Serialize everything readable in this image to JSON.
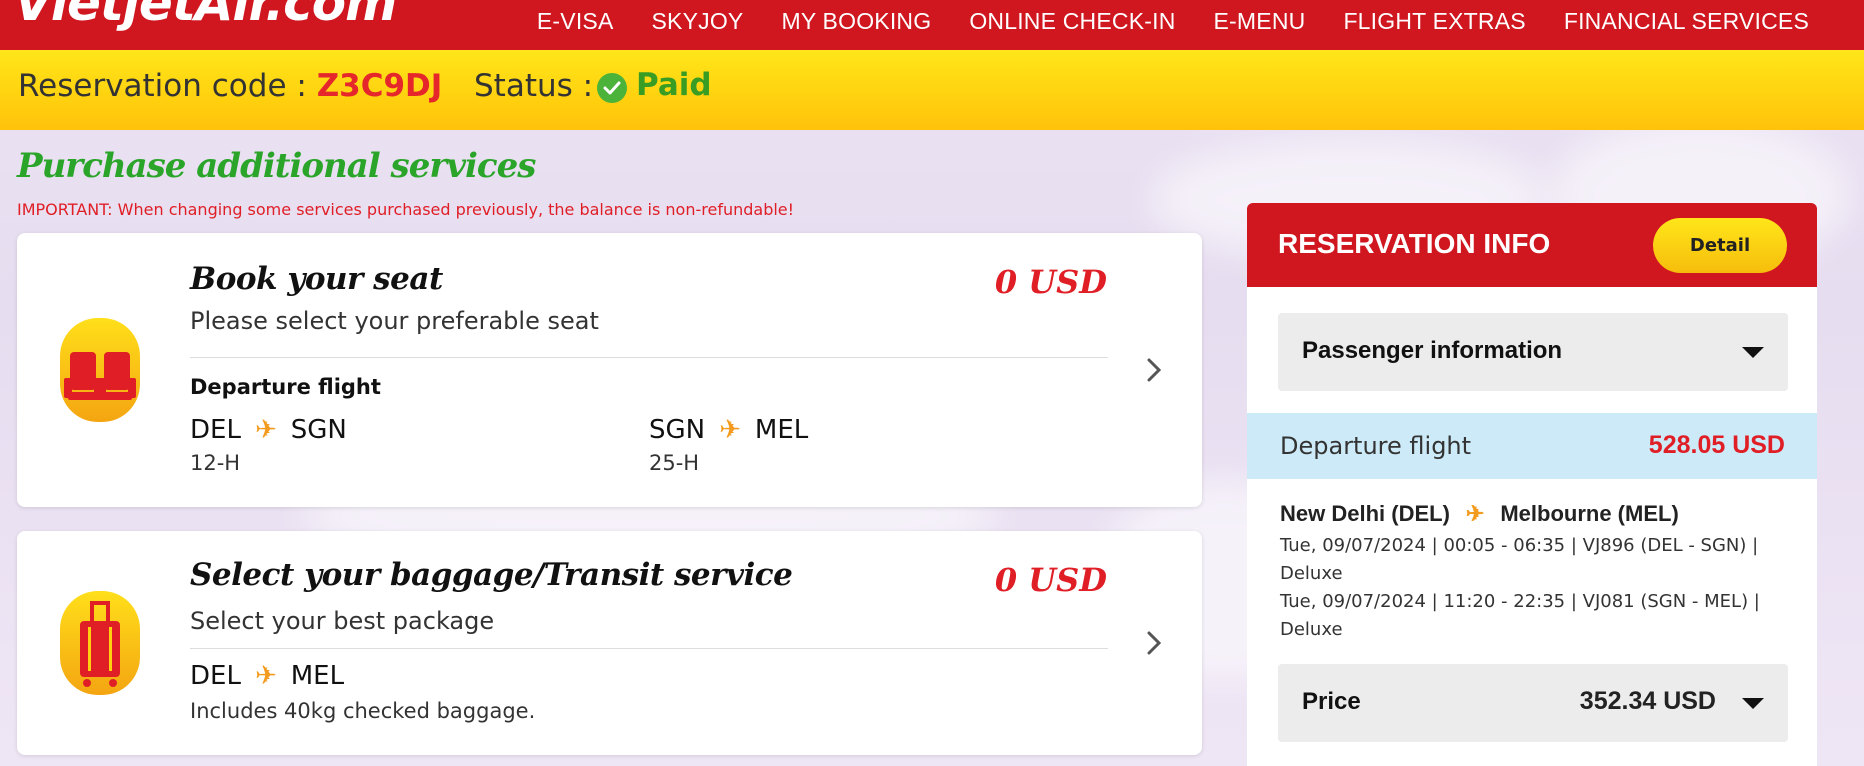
{
  "brand": {
    "logo_text": "VietjetAir.com"
  },
  "nav": {
    "items": [
      "E-VISA",
      "SKYJOY",
      "MY BOOKING",
      "ONLINE CHECK-IN",
      "E-MENU",
      "FLIGHT EXTRAS",
      "FINANCIAL SERVICES"
    ]
  },
  "status_bar": {
    "reservation_label": "Reservation code : ",
    "reservation_code": "Z3C9DJ",
    "status_label": "Status :",
    "status_value": "Paid"
  },
  "main": {
    "title": "Purchase additional services",
    "important": "IMPORTANT: When changing some services purchased previously, the balance is non-refundable!",
    "seat_card": {
      "title": "Book your seat",
      "subtitle": "Please select your preferable seat",
      "price": "0 USD",
      "flight_label": "Departure flight",
      "legs": [
        {
          "from": "DEL",
          "to": "SGN",
          "seat": "12-H"
        },
        {
          "from": "SGN",
          "to": "MEL",
          "seat": "25-H"
        }
      ]
    },
    "baggage_card": {
      "title": "Select your baggage/Transit service",
      "subtitle": "Select your best package",
      "price": "0 USD",
      "route_from": "DEL",
      "route_to": "MEL",
      "note": "Includes 40kg checked baggage."
    }
  },
  "reservation_info": {
    "title": "RESERVATION INFO",
    "detail_button": "Detail",
    "passenger_dropdown": "Passenger information",
    "departure_label": "Departure flight",
    "departure_price": "528.05 USD",
    "route_from": "New Delhi (DEL)",
    "route_to": "Melbourne (MEL)",
    "segments": [
      "Tue, 09/07/2024 | 00:05 - 06:35 | VJ896 (DEL - SGN) | Deluxe",
      "Tue, 09/07/2024 | 11:20 - 22:35 | VJ081 (SGN - MEL) | Deluxe"
    ],
    "price_label": "Price",
    "price_value": "352.34 USD"
  },
  "colors": {
    "brand_red": "#d0161f",
    "accent_yellow": "#ffd10f",
    "paid_green": "#3a9d23",
    "price_red": "#e01e26"
  },
  "icons": [
    "check-icon",
    "seat-icon",
    "luggage-icon",
    "chevron-right-icon",
    "plane-icon",
    "caret-down-icon"
  ]
}
